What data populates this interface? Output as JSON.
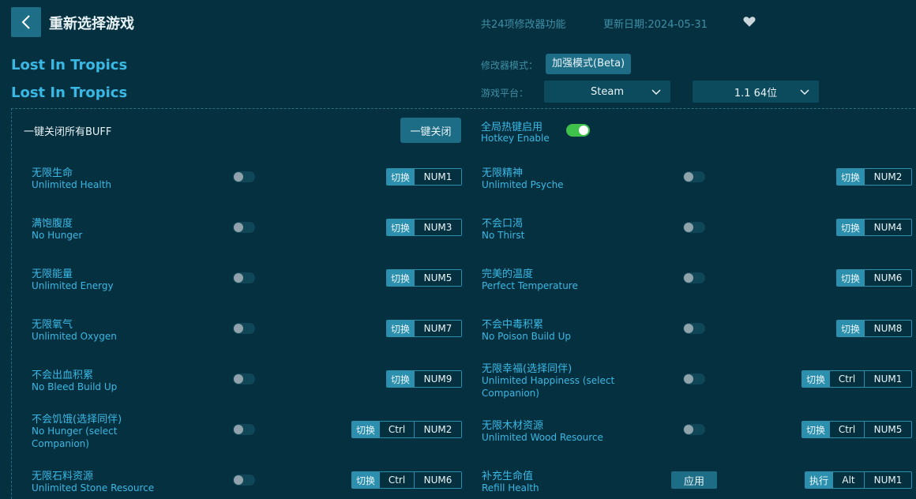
{
  "header": {
    "title": "重新选择游戏",
    "feature_count": "共24项修改器功能",
    "update_date": "更新日期:2024-05-31"
  },
  "game": {
    "title_line1": "Lost In Tropics",
    "title_line2": "Lost In Tropics"
  },
  "settings": {
    "mode_label": "修改器模式：",
    "mode_value": "加强模式(Beta)",
    "platform_label": "游戏平台：",
    "platform_value": "Steam",
    "version_value": "1.1 64位"
  },
  "buff": {
    "label": "一键关闭所有BUFF",
    "close_all": "一键关闭"
  },
  "hotkey": {
    "cn": "全局热键启用",
    "en": "Hotkey Enable",
    "enabled": true
  },
  "labels": {
    "toggle_key": "切换",
    "exec_key": "执行",
    "apply": "应用"
  },
  "features": [
    {
      "cn": "无限生命",
      "en": "Unlimited Health",
      "keys": [
        "NUM1"
      ]
    },
    {
      "cn": "无限精神",
      "en": "Unlimited Psyche",
      "keys": [
        "NUM2"
      ]
    },
    {
      "cn": "满饱腹度",
      "en": "No Hunger",
      "keys": [
        "NUM3"
      ]
    },
    {
      "cn": "不会口渴",
      "en": "No Thirst",
      "keys": [
        "NUM4"
      ]
    },
    {
      "cn": "无限能量",
      "en": "Unlimited Energy",
      "keys": [
        "NUM5"
      ]
    },
    {
      "cn": "完美的温度",
      "en": "Perfect Temperature",
      "keys": [
        "NUM6"
      ]
    },
    {
      "cn": "无限氧气",
      "en": "Unlimited Oxygen",
      "keys": [
        "NUM7"
      ]
    },
    {
      "cn": "不会中毒积累",
      "en": "No Poison Build Up",
      "keys": [
        "NUM8"
      ]
    },
    {
      "cn": "不会出血积累",
      "en": "No Bleed Build Up",
      "keys": [
        "NUM9"
      ]
    },
    {
      "cn": "无限幸福(选择同伴)",
      "en": "Unlimited Happiness (select Companion)",
      "keys": [
        "Ctrl",
        "NUM1"
      ]
    },
    {
      "cn": "不会饥饿(选择同伴)",
      "en": "No Hunger (select Companion)",
      "keys": [
        "Ctrl",
        "NUM2"
      ]
    },
    {
      "cn": "无限木材资源",
      "en": "Unlimited Wood Resource",
      "keys": [
        "Ctrl",
        "NUM5"
      ]
    },
    {
      "cn": "无限石料资源",
      "en": "Unlimited Stone Resource",
      "keys": [
        "Ctrl",
        "NUM6"
      ]
    },
    {
      "cn": "补充生命值",
      "en": "Refill Health",
      "keys": [
        "Alt",
        "NUM1"
      ]
    }
  ],
  "colors": {
    "background": "#05303f",
    "accent_text": "#3ab8e4",
    "button": "#1d6d86",
    "toggle_on": "#3fc24c"
  }
}
